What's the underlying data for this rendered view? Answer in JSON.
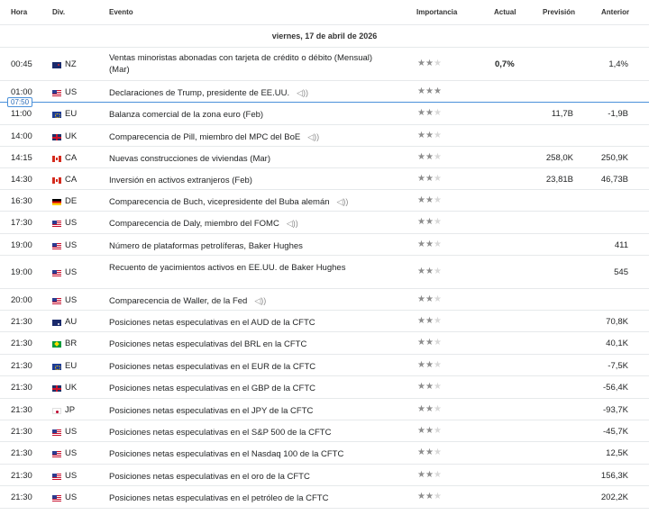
{
  "headers": {
    "hora": "Hora",
    "div": "Div.",
    "evento": "Evento",
    "importancia": "Importancia",
    "actual": "Actual",
    "prevision": "Previsión",
    "anterior": "Anterior"
  },
  "date_label": "viernes, 17 de abril de 2026",
  "current_time": "07:50",
  "colors": {
    "accent": "#4a90d9",
    "star_on": "#8d8d8d",
    "star_off": "#d8d8d8"
  },
  "rows": [
    {
      "time": "00:45",
      "flag": "nz-flag-icon",
      "cur": "NZ",
      "event": "Ventas minoristas abonadas con tarjeta de crédito o débito (Mensual) (Mar)",
      "stars": 2,
      "actual": "0,7%",
      "prevision": "",
      "anterior": "1,4%",
      "audio": false
    },
    {
      "time": "01:00",
      "flag": "us-flag-icon",
      "cur": "US",
      "event": "Declaraciones de Trump, presidente de EE.UU.",
      "stars": 3,
      "actual": "",
      "prevision": "",
      "anterior": "",
      "audio": true
    },
    {
      "time": "11:00",
      "flag": "eu-flag-icon",
      "cur": "EU",
      "event": "Balanza comercial de la zona euro  (Feb)",
      "stars": 2,
      "actual": "",
      "prevision": "11,7B",
      "anterior": "-1,9B",
      "audio": false
    },
    {
      "time": "14:00",
      "flag": "uk-flag-icon",
      "cur": "UK",
      "event": "Comparecencia de Pill, miembro del MPC del BoE",
      "stars": 2,
      "actual": "",
      "prevision": "",
      "anterior": "",
      "audio": true
    },
    {
      "time": "14:15",
      "flag": "ca-flag-icon",
      "cur": "CA",
      "event": "Nuevas construcciones de viviendas  (Mar)",
      "stars": 2,
      "actual": "",
      "prevision": "258,0K",
      "anterior": "250,9K",
      "audio": false
    },
    {
      "time": "14:30",
      "flag": "ca-flag-icon",
      "cur": "CA",
      "event": "Inversión en activos extranjeros  (Feb)",
      "stars": 2,
      "actual": "",
      "prevision": "23,81B",
      "anterior": "46,73B",
      "audio": false
    },
    {
      "time": "16:30",
      "flag": "de-flag-icon",
      "cur": "DE",
      "event": "Comparecencia de Buch, vicepresidente del Buba alemán",
      "stars": 2,
      "actual": "",
      "prevision": "",
      "anterior": "",
      "audio": true
    },
    {
      "time": "17:30",
      "flag": "us-flag-icon",
      "cur": "US",
      "event": "Comparecencia de Daly, miembro del FOMC",
      "stars": 2,
      "actual": "",
      "prevision": "",
      "anterior": "",
      "audio": true
    },
    {
      "time": "19:00",
      "flag": "us-flag-icon",
      "cur": "US",
      "event": "Número de plataformas petrolíferas, Baker Hughes",
      "stars": 2,
      "actual": "",
      "prevision": "",
      "anterior": "411",
      "audio": false
    },
    {
      "time": "19:00",
      "flag": "us-flag-icon",
      "cur": "US",
      "event": "Recuento de yacimientos activos en EE.UU. de Baker Hughes",
      "stars": 2,
      "actual": "",
      "prevision": "",
      "anterior": "545",
      "audio": false
    },
    {
      "time": "20:00",
      "flag": "us-flag-icon",
      "cur": "US",
      "event": "Comparecencia de Waller, de la Fed",
      "stars": 2,
      "actual": "",
      "prevision": "",
      "anterior": "",
      "audio": true
    },
    {
      "time": "21:30",
      "flag": "au-flag-icon",
      "cur": "AU",
      "event": "Posiciones netas especulativas en el AUD de la CFTC",
      "stars": 2,
      "actual": "",
      "prevision": "",
      "anterior": "70,8K",
      "audio": false
    },
    {
      "time": "21:30",
      "flag": "br-flag-icon",
      "cur": "BR",
      "event": "Posiciones netas especulativas del BRL en la CFTC",
      "stars": 2,
      "actual": "",
      "prevision": "",
      "anterior": "40,1K",
      "audio": false
    },
    {
      "time": "21:30",
      "flag": "eu-flag-icon",
      "cur": "EU",
      "event": "Posiciones netas especulativas en el EUR de la CFTC",
      "stars": 2,
      "actual": "",
      "prevision": "",
      "anterior": "-7,5K",
      "audio": false
    },
    {
      "time": "21:30",
      "flag": "uk-flag-icon",
      "cur": "UK",
      "event": "Posiciones netas especulativas en el GBP de la CFTC",
      "stars": 2,
      "actual": "",
      "prevision": "",
      "anterior": "-56,4K",
      "audio": false
    },
    {
      "time": "21:30",
      "flag": "jp-flag-icon",
      "cur": "JP",
      "event": "Posiciones netas especulativas en el JPY de la CFTC",
      "stars": 2,
      "actual": "",
      "prevision": "",
      "anterior": "-93,7K",
      "audio": false
    },
    {
      "time": "21:30",
      "flag": "us-flag-icon",
      "cur": "US",
      "event": "Posiciones netas especulativas en el S&P 500 de la CFTC",
      "stars": 2,
      "actual": "",
      "prevision": "",
      "anterior": "-45,7K",
      "audio": false
    },
    {
      "time": "21:30",
      "flag": "us-flag-icon",
      "cur": "US",
      "event": "Posiciones netas especulativas en el Nasdaq 100 de la CFTC",
      "stars": 2,
      "actual": "",
      "prevision": "",
      "anterior": "12,5K",
      "audio": false
    },
    {
      "time": "21:30",
      "flag": "us-flag-icon",
      "cur": "US",
      "event": "Posiciones netas especulativas en el oro de la CFTC",
      "stars": 2,
      "actual": "",
      "prevision": "",
      "anterior": "156,3K",
      "audio": false
    },
    {
      "time": "21:30",
      "flag": "us-flag-icon",
      "cur": "US",
      "event": "Posiciones netas especulativas en el petróleo de la CFTC",
      "stars": 2,
      "actual": "",
      "prevision": "",
      "anterior": "202,2K",
      "audio": false
    }
  ]
}
